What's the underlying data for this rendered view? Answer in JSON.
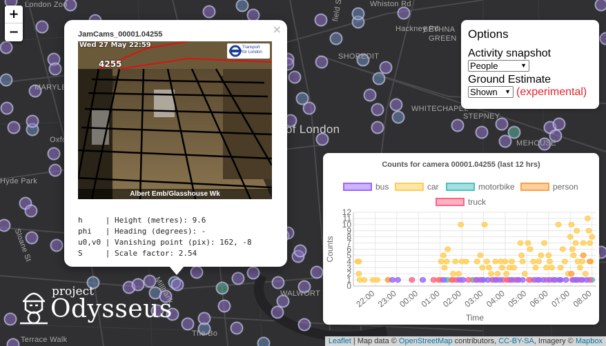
{
  "map": {
    "labels": [
      "London Zoo",
      "Whiston Rd",
      "Hackney Rd",
      "BETHNA",
      "GREEN",
      "SHOREDIT",
      "MARYLE",
      "WHITECHAPEL",
      "STEPNEY",
      "MEHOUSE",
      "Oxford",
      "of London",
      "Hyde Park",
      "Sloane St",
      "WALWORT",
      "Terrace Walk",
      "The Bo",
      "Millbank",
      "field St"
    ],
    "marker_colors": [
      "#8e72c9",
      "#6b8ab8",
      "#5db59c",
      "#3aa35f"
    ]
  },
  "zoom": {
    "in_label": "+",
    "out_label": "−"
  },
  "popup": {
    "close_label": "×",
    "title": "JamCams_00001.04255",
    "cam_timestamp": "Wed 27 May 22:59",
    "cam_id": "4255",
    "tfl_line1": "Transport",
    "tfl_line2": "for London",
    "cam_caption": "Albert Emb/Glasshouse Wk",
    "params": [
      "h     | Height (metres): 9.6",
      "phi   | Heading (degrees): -",
      "u0,v0 | Vanishing point (pix): 162, -8",
      "S     | Scale factor: 2.54"
    ]
  },
  "options": {
    "title": "Options",
    "activity_label": "Activity snapshot",
    "activity_value": "People",
    "ground_label": "Ground Estimate",
    "ground_value": "Shown",
    "experimental_label": "(experimental)",
    "experimental_color": "#e0242b"
  },
  "chart_data": {
    "type": "scatter",
    "title": "Counts for camera 00001.04255 (last 12 hrs)",
    "xlabel": "Time",
    "ylabel": "Counts",
    "ylim": [
      0,
      12
    ],
    "yticks": [
      0,
      1,
      2,
      3,
      4,
      5,
      6,
      7,
      8,
      9,
      10,
      11,
      12
    ],
    "xticks": [
      "22:00",
      "23:00",
      "00:00",
      "01:00",
      "02:00",
      "03:00",
      "04:00",
      "05:00",
      "06:00",
      "07:00",
      "08:00"
    ],
    "legend_position": "top",
    "grid": true,
    "series": [
      {
        "name": "bus",
        "color": "#9966ff",
        "points": [
          [
            1.8,
            1
          ],
          [
            2.05,
            1
          ],
          [
            3.2,
            1
          ],
          [
            4.15,
            1
          ],
          [
            4.9,
            1
          ],
          [
            5.05,
            1
          ],
          [
            5.7,
            1
          ],
          [
            5.95,
            1
          ],
          [
            6.2,
            1
          ],
          [
            6.55,
            1
          ],
          [
            6.75,
            1
          ],
          [
            7.3,
            1
          ],
          [
            7.6,
            1
          ],
          [
            7.8,
            1
          ],
          [
            8.35,
            1
          ],
          [
            8.55,
            1
          ],
          [
            8.75,
            1
          ],
          [
            9.05,
            1
          ],
          [
            9.3,
            1
          ],
          [
            9.5,
            1
          ],
          [
            9.55,
            1
          ],
          [
            9.8,
            1
          ],
          [
            10.15,
            1
          ],
          [
            10.3,
            1
          ],
          [
            10.55,
            1
          ],
          [
            10.75,
            1
          ]
        ]
      },
      {
        "name": "car",
        "color": "#ffcd56",
        "points": [
          [
            0.2,
            4
          ],
          [
            0.25,
            4
          ],
          [
            0.25,
            2
          ],
          [
            0.3,
            1
          ],
          [
            0.5,
            1
          ],
          [
            0.9,
            1
          ],
          [
            1.1,
            1
          ],
          [
            1.6,
            1
          ],
          [
            4.05,
            4
          ],
          [
            4.15,
            5
          ],
          [
            4.2,
            3
          ],
          [
            4.3,
            4
          ],
          [
            4.35,
            6
          ],
          [
            4.45,
            1
          ],
          [
            4.6,
            2
          ],
          [
            4.7,
            4
          ],
          [
            4.85,
            2
          ],
          [
            4.95,
            10
          ],
          [
            5.0,
            4
          ],
          [
            5.2,
            4
          ],
          [
            5.5,
            1
          ],
          [
            5.7,
            4
          ],
          [
            5.85,
            5
          ],
          [
            5.95,
            3
          ],
          [
            6.05,
            10
          ],
          [
            6.15,
            4
          ],
          [
            6.25,
            3
          ],
          [
            6.35,
            2
          ],
          [
            6.55,
            4
          ],
          [
            6.65,
            2
          ],
          [
            6.8,
            4
          ],
          [
            6.85,
            3
          ],
          [
            7.0,
            4
          ],
          [
            7.05,
            2
          ],
          [
            7.2,
            3
          ],
          [
            7.3,
            4
          ],
          [
            7.4,
            3
          ],
          [
            7.5,
            1
          ],
          [
            7.7,
            7
          ],
          [
            7.75,
            5
          ],
          [
            7.8,
            4
          ],
          [
            7.9,
            2
          ],
          [
            8.05,
            7
          ],
          [
            8.15,
            6
          ],
          [
            8.3,
            4
          ],
          [
            8.4,
            3
          ],
          [
            8.55,
            4
          ],
          [
            8.65,
            5
          ],
          [
            8.8,
            7
          ],
          [
            8.9,
            3
          ],
          [
            9.0,
            5
          ],
          [
            9.05,
            4
          ],
          [
            9.15,
            3
          ],
          [
            9.25,
            1
          ],
          [
            9.45,
            10
          ],
          [
            9.55,
            3
          ],
          [
            9.65,
            6
          ],
          [
            9.75,
            4
          ],
          [
            9.9,
            2
          ],
          [
            10.0,
            8
          ],
          [
            10.05,
            10
          ],
          [
            10.1,
            6
          ],
          [
            10.15,
            5
          ],
          [
            10.25,
            7
          ],
          [
            10.3,
            9
          ],
          [
            10.35,
            4
          ],
          [
            10.45,
            3
          ],
          [
            10.55,
            4
          ],
          [
            10.6,
            7
          ],
          [
            10.7,
            2
          ],
          [
            10.8,
            11
          ],
          [
            10.85,
            9
          ],
          [
            10.9,
            7
          ],
          [
            10.95,
            4
          ],
          [
            11.0,
            8
          ]
        ]
      },
      {
        "name": "motorbike",
        "color": "#4bc0c0",
        "points": [
          [
            4.3,
            1
          ],
          [
            5.5,
            1
          ],
          [
            6.0,
            1
          ],
          [
            6.45,
            1
          ],
          [
            9.5,
            1
          ],
          [
            10.3,
            1
          ],
          [
            11.0,
            1
          ]
        ]
      },
      {
        "name": "person",
        "color": "#ff9f40",
        "points": [
          [
            1.6,
            1
          ],
          [
            3.9,
            1
          ],
          [
            4.6,
            1
          ],
          [
            5.9,
            1
          ],
          [
            7.1,
            1
          ],
          [
            8.2,
            1
          ],
          [
            9.3,
            1
          ],
          [
            10.05,
            2
          ],
          [
            10.4,
            1
          ],
          [
            10.6,
            5
          ],
          [
            10.9,
            4
          ]
        ]
      },
      {
        "name": "truck",
        "color": "#ff6384",
        "points": [
          [
            2.7,
            1
          ],
          [
            3.7,
            1
          ],
          [
            4.0,
            1
          ],
          [
            4.55,
            1
          ],
          [
            4.75,
            1
          ],
          [
            5.3,
            1
          ],
          [
            5.65,
            1
          ],
          [
            5.85,
            1
          ],
          [
            6.4,
            1
          ],
          [
            6.6,
            1
          ],
          [
            6.9,
            1
          ],
          [
            7.1,
            1
          ],
          [
            7.2,
            1
          ],
          [
            7.45,
            1
          ],
          [
            7.6,
            1
          ],
          [
            8.1,
            1
          ],
          [
            8.5,
            1
          ],
          [
            8.9,
            1
          ],
          [
            9.2,
            1
          ],
          [
            10.1,
            1
          ],
          [
            10.25,
            1
          ],
          [
            10.5,
            1
          ],
          [
            10.9,
            1
          ]
        ]
      }
    ]
  },
  "logo": {
    "line1": "project",
    "line2": "Odysseus"
  },
  "attribution": {
    "leaflet": "Leaflet",
    "sep1": " | Map data © ",
    "osm": "OpenStreetMap",
    "sep2": " contributors, ",
    "license": "CC-BY-SA",
    "sep3": ", Imagery © ",
    "mapbox": "Mapbox"
  }
}
